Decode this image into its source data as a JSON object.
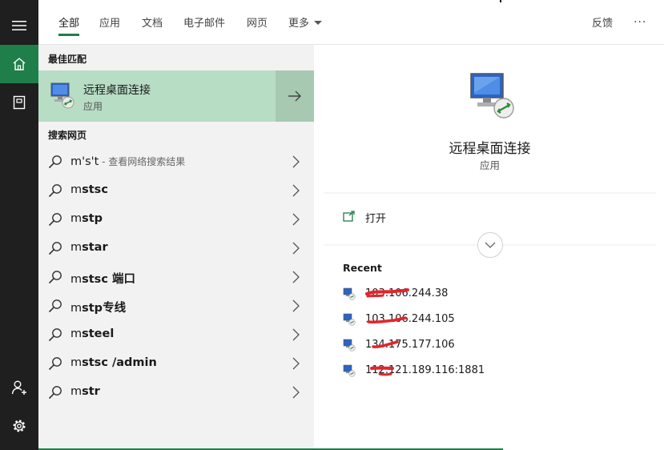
{
  "tabs": [
    {
      "label": "全部",
      "active": true
    },
    {
      "label": "应用"
    },
    {
      "label": "文档"
    },
    {
      "label": "电子邮件"
    },
    {
      "label": "网页"
    },
    {
      "label": "更多"
    }
  ],
  "header": {
    "feedback": "反馈",
    "more": "···"
  },
  "sidebar_icons": [
    "menu-icon",
    "home-icon",
    "notebook-icon",
    "account-add-icon",
    "gear-icon"
  ],
  "best_match": {
    "section": "最佳匹配",
    "title": "远程桌面连接",
    "subtitle": "应用"
  },
  "web_search": {
    "section": "搜索网页",
    "items": [
      {
        "typed": "m's't",
        "rest": "",
        "suffix": " - 查看网络搜索结果"
      },
      {
        "typed": "m",
        "rest": "stsc",
        "suffix": ""
      },
      {
        "typed": "m",
        "rest": "stp",
        "suffix": ""
      },
      {
        "typed": "m",
        "rest": "star",
        "suffix": ""
      },
      {
        "typed": "m",
        "rest": "stsc 端口",
        "suffix": ""
      },
      {
        "typed": "m",
        "rest": "stp专线",
        "suffix": ""
      },
      {
        "typed": "m",
        "rest": "steel",
        "suffix": ""
      },
      {
        "typed": "m",
        "rest": "stsc /admin",
        "suffix": ""
      },
      {
        "typed": "m",
        "rest": "str",
        "suffix": ""
      }
    ]
  },
  "detail": {
    "title": "远程桌面连接",
    "subtitle": "应用",
    "open_label": "打开",
    "recent_title": "Recent",
    "recent": [
      "103.106.244.38",
      "103.106.244.105",
      "134.175.177.106",
      "112.121.189.116:1881"
    ]
  },
  "colors": {
    "accent": "#1e7f4a",
    "highlight": "#b7ddc4",
    "redaction": "#e8222a"
  }
}
